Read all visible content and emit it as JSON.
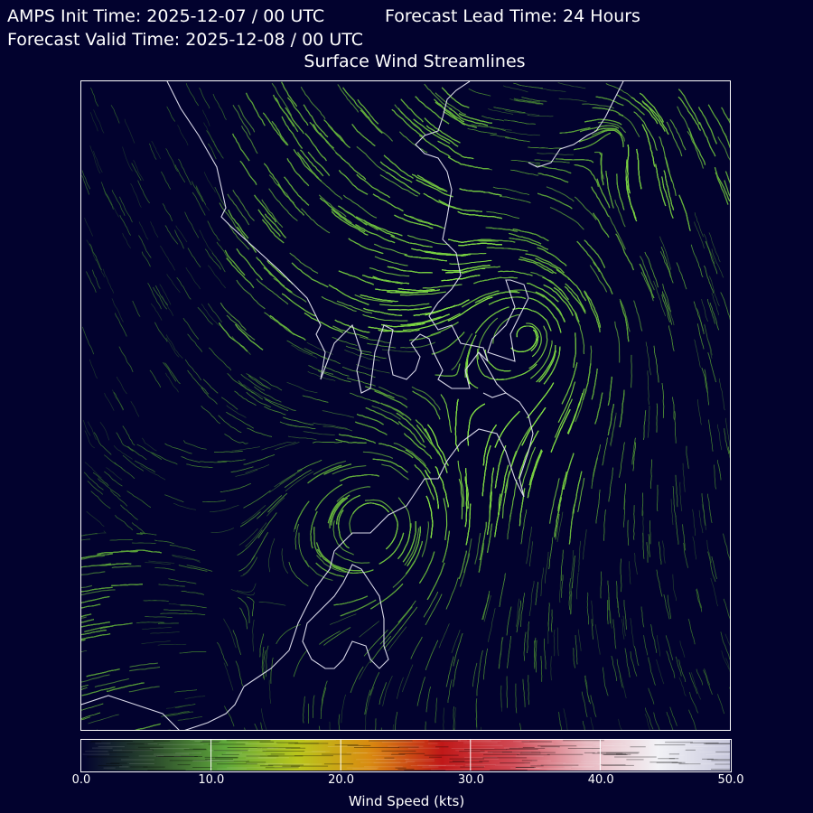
{
  "header": {
    "init_time": "AMPS Init Time: 2025-12-07 / 00 UTC",
    "lead_time": "Forecast Lead Time: 24 Hours",
    "valid_time": "Forecast Valid Time: 2025-12-08 / 00 UTC",
    "title": "Surface Wind Streamlines"
  },
  "colorbar": {
    "label": "Wind Speed (kts)",
    "min": 0,
    "max": 50,
    "ticks": [
      "0.0",
      "10.0",
      "20.0",
      "30.0",
      "40.0",
      "50.0"
    ],
    "tick_values": [
      0,
      10,
      20,
      30,
      40,
      50
    ],
    "colors": [
      "#02022e",
      "#2b4a2c",
      "#5fa83a",
      "#b9c61c",
      "#d98a10",
      "#c01818",
      "#d04a55",
      "#e8b8c0",
      "#f2f2f6",
      "#c8c8dc"
    ]
  },
  "map": {
    "streamline_color": "#6fbd47",
    "coastline_color": "#d8d8e8"
  }
}
